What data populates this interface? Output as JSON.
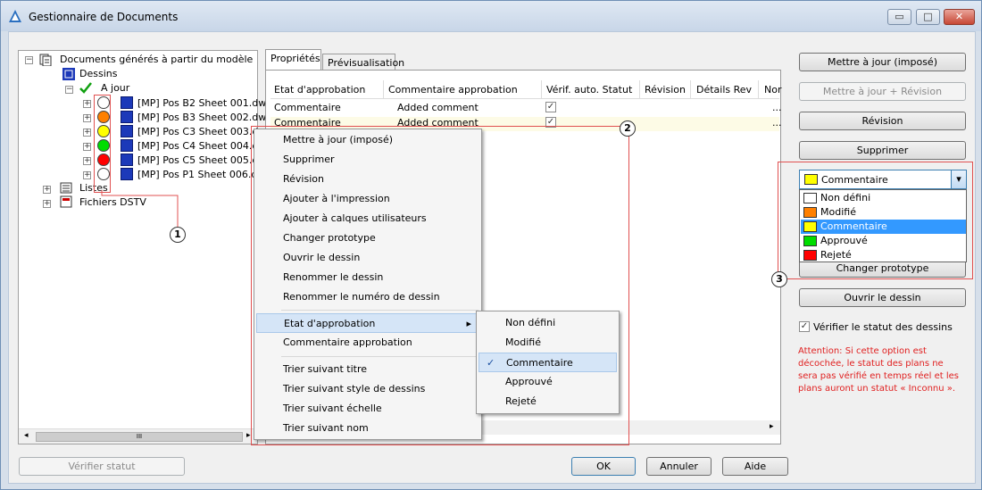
{
  "window": {
    "title": "Gestionnaire de Documents",
    "minimize": "▭",
    "maximize": "□",
    "close": "✕"
  },
  "tree": {
    "root": "Documents générés à partir du modèle",
    "dessins": "Dessins",
    "ajour": "A jour",
    "sheets": [
      {
        "label": "[MP] Pos B2 Sheet 001.dwg",
        "status_color": "#ffffff"
      },
      {
        "label": "[MP] Pos B3 Sheet 002.dwg",
        "status_color": "#ff8000"
      },
      {
        "label": "[MP] Pos C3 Sheet 003.dwg",
        "status_color": "#ffff00"
      },
      {
        "label": "[MP] Pos C4 Sheet 004.dw",
        "status_color": "#00dd00"
      },
      {
        "label": "[MP] Pos C5 Sheet 005.dw",
        "status_color": "#ff0000"
      },
      {
        "label": "[MP] Pos P1 Sheet 006.dw",
        "status_color": "#ffffff"
      }
    ],
    "listes": "Listes",
    "dstv": "Fichiers DSTV",
    "scroll_thumb": "III"
  },
  "tabs": {
    "properties": "Propriétés",
    "preview": "Prévisualisation"
  },
  "grid": {
    "columns": [
      "Etat d'approbation",
      "Commentaire approbation",
      "Vérif. auto. Statut",
      "Révision",
      "Détails Rev",
      "Nor"
    ],
    "rows": [
      {
        "state": "Commentaire",
        "comment": "Added comment",
        "check": "✓",
        "more": "..."
      },
      {
        "state": "Commentaire",
        "comment": "Added comment",
        "check": "✓",
        "more": "..."
      }
    ]
  },
  "context_menu": {
    "items_a": [
      "Mettre à jour (imposé)",
      "Supprimer",
      "Révision",
      "Ajouter à l'impression",
      "Ajouter à calques utilisateurs",
      "Changer prototype",
      "Ouvrir le dessin",
      "Renommer le dessin",
      "Renommer le numéro de dessin"
    ],
    "items_b": [
      "Etat d'approbation",
      "Commentaire approbation"
    ],
    "items_c": [
      "Trier suivant titre",
      "Trier suivant style de dessins",
      "Trier suivant échelle",
      "Trier suivant nom"
    ],
    "submenu_arrow": "▸"
  },
  "submenu": {
    "items": [
      "Non défini",
      "Modifié",
      "Commentaire",
      "Approuvé",
      "Rejeté"
    ],
    "checked": "✓"
  },
  "right_buttons": {
    "update_forced": "Mettre à jour (imposé)",
    "update_revision": "Mettre à jour + Révision",
    "revision": "Révision",
    "delete": "Supprimer",
    "change_prototype": "Changer prototype",
    "open_drawing": "Ouvrir le dessin"
  },
  "dropdown": {
    "selected": "Commentaire",
    "arrow": "▾",
    "options": [
      {
        "label": "Non défini",
        "color": "#ffffff"
      },
      {
        "label": "Modifié",
        "color": "#ff8000"
      },
      {
        "label": "Commentaire",
        "color": "#ffff00"
      },
      {
        "label": "Approuvé",
        "color": "#00dd00"
      },
      {
        "label": "Rejeté",
        "color": "#ff0000"
      }
    ]
  },
  "verify": {
    "label": "Vérifier le statut des dessins",
    "check": "✓"
  },
  "warning": "Attention: Si cette option est décochée, le statut des plans ne sera pas vérifié en temps réel et les plans auront un statut « Inconnu ».",
  "bottom": {
    "verify_status": "Vérifier statut",
    "ok": "OK",
    "cancel": "Annuler",
    "help": "Aide"
  },
  "callouts": [
    "1",
    "2",
    "3"
  ]
}
